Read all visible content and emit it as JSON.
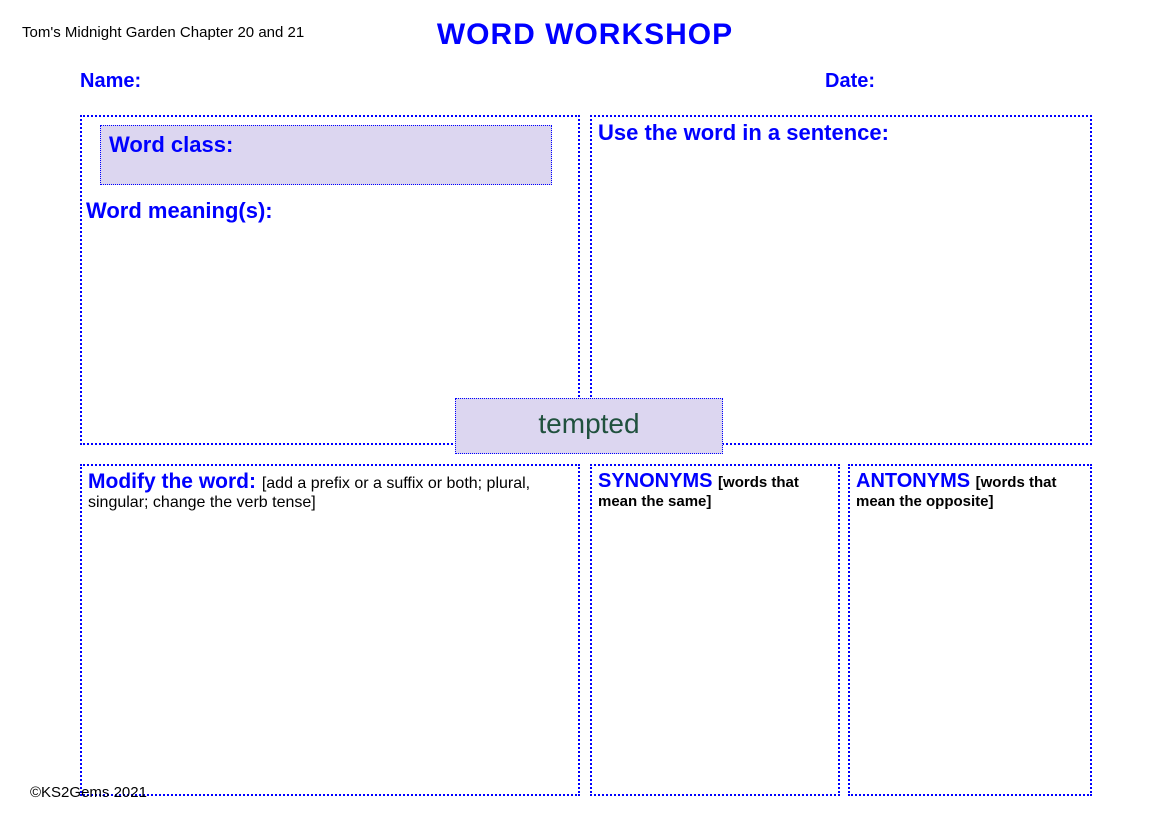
{
  "chapter": "Tom's Midnight Garden Chapter 20 and 21",
  "title": "WORD WORKSHOP",
  "name_label": "Name:",
  "date_label": "Date:",
  "word_class_label": "Word class:",
  "word_meaning_label": "Word meaning(s):",
  "sentence_label": "Use the word in a sentence:",
  "center_word": "tempted",
  "modify": {
    "label": "Modify the word: ",
    "sub": "[add a prefix or a suffix or both; plural, singular; change the verb tense]"
  },
  "synonyms": {
    "label": "SYNONYMS ",
    "sub": "[words that mean the same]"
  },
  "antonyms": {
    "label": "ANTONYMS ",
    "sub": "[words that mean the opposite]"
  },
  "copyright": "©KS2Gems 2021"
}
